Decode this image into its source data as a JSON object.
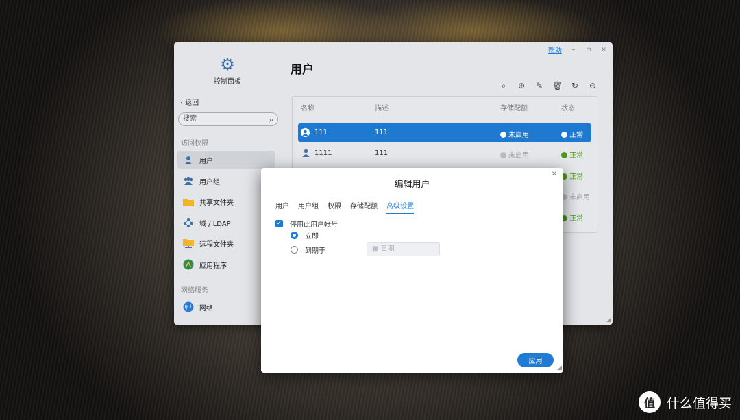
{
  "window": {
    "help_label": "帮助",
    "minimize": "–",
    "maximize": "▫",
    "close": "×"
  },
  "sidebar": {
    "app_title": "控制面板",
    "back_label": "返回",
    "search_placeholder": "搜索",
    "section_access": "访问权限",
    "section_network": "网络服务",
    "items": [
      {
        "label": "用户",
        "icon": "user-icon"
      },
      {
        "label": "用户组",
        "icon": "user-group-icon"
      },
      {
        "label": "共享文件夹",
        "icon": "folder-icon"
      },
      {
        "label": "域 / LDAP",
        "icon": "network-nodes-icon"
      },
      {
        "label": "远程文件夹",
        "icon": "remote-folder-icon"
      },
      {
        "label": "应用程序",
        "icon": "app-icon"
      },
      {
        "label": "网络",
        "icon": "globe-icon"
      }
    ]
  },
  "main": {
    "title": "用户",
    "toolbar": [
      "search-icon",
      "add-icon",
      "edit-icon",
      "delete-icon",
      "refresh-icon",
      "more-icon"
    ],
    "columns": {
      "name": "名称",
      "desc": "描述",
      "quota": "存储配额",
      "status": "状态"
    },
    "rows": [
      {
        "name": "111",
        "desc": "111",
        "quota": "未启用",
        "status": "正常"
      },
      {
        "name": "1111",
        "desc": "111",
        "quota": "未启用",
        "status": "正常"
      }
    ],
    "extra_status": [
      "正常",
      "未启用",
      "正常"
    ]
  },
  "modal": {
    "title": "编辑用户",
    "close": "×",
    "tabs": [
      "用户",
      "用户组",
      "权限",
      "存储配额",
      "高级设置"
    ],
    "active_tab": 4,
    "disable_account_label": "停用此用户帐号",
    "option_now": "立即",
    "option_expire": "到期于",
    "date_placeholder": "日期",
    "apply_label": "应用"
  },
  "watermark": {
    "logo": "值",
    "text": "什么值得买"
  },
  "colors": {
    "accent": "#1e7bd6",
    "ok": "#4c9a1b"
  }
}
